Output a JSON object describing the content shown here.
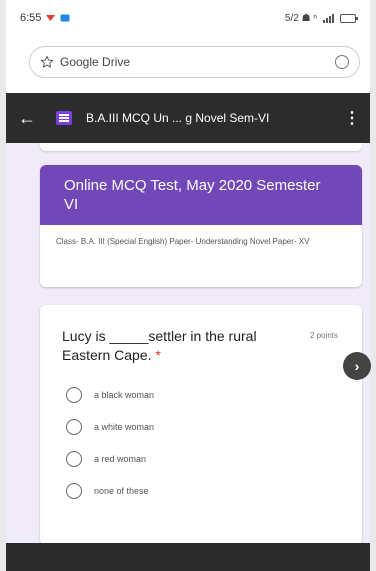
{
  "status_bar": {
    "time": "6:55",
    "right_text": "5/2 ☗ ⁿ"
  },
  "browser": {
    "address_text": "Google Drive"
  },
  "title_bar": {
    "title": "B.A.III MCQ Un ... g Novel Sem-VI"
  },
  "form_header": {
    "title": "Online MCQ Test, May 2020 Semester VI",
    "description": "Class- B.A. III (Special English) Paper- Understanding Novel Paper- XV",
    "accent_color": "#7248b9"
  },
  "question": {
    "text": "Lucy is _____settler in the rural Eastern Cape.",
    "required_mark": "*",
    "points": "2 points",
    "options": [
      {
        "label": "a black woman"
      },
      {
        "label": "a white woman"
      },
      {
        "label": "a red woman"
      },
      {
        "label": "none of these"
      }
    ]
  },
  "icons": {
    "back": "arrow-left-icon",
    "form": "google-forms-icon",
    "menu": "more-vertical-icon",
    "next": "chevron-right-icon",
    "bookmark": "star-icon",
    "reload": "reload-icon"
  }
}
